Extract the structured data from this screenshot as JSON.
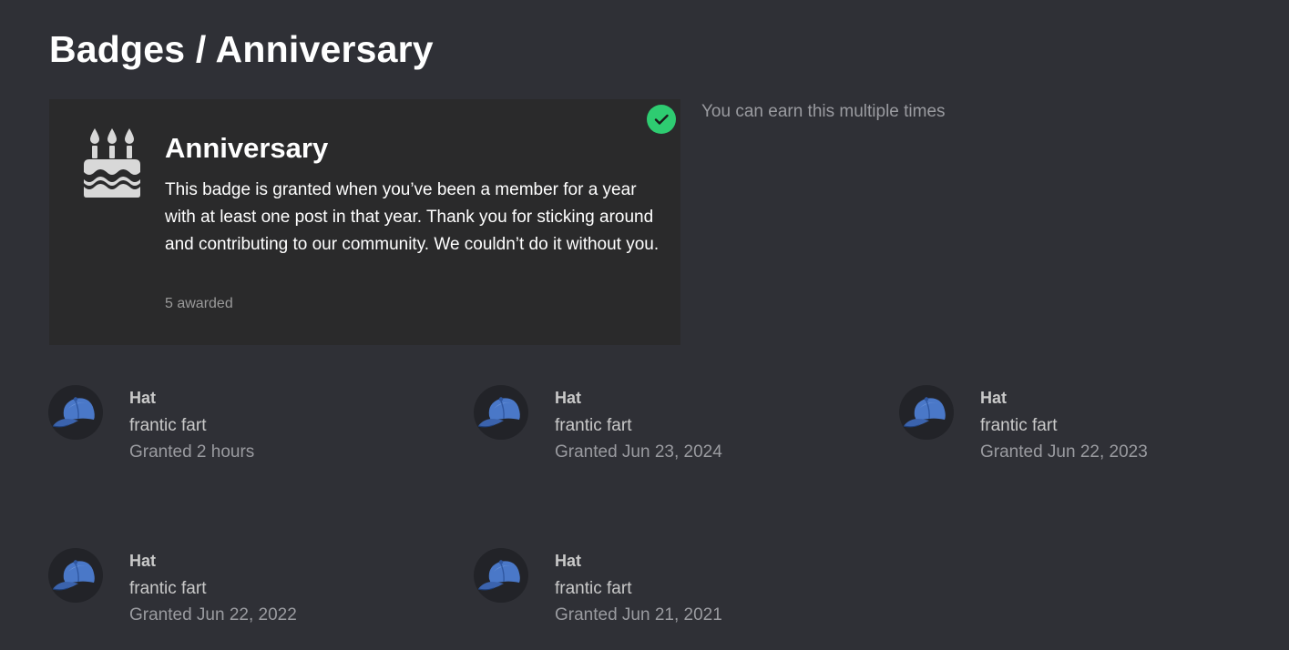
{
  "page": {
    "title": "Badges / Anniversary"
  },
  "badge": {
    "icon": "birthday-cake-icon",
    "name": "Anniversary",
    "description": "This badge is granted when you’ve been a member for a year with at least one post in that year. Thank you for sticking around and contributing to our community. We couldn’t do it without you.",
    "awarded": "5 awarded",
    "granted_icon": "check-circle-icon",
    "earn_note": "You can earn this multiple times"
  },
  "colors": {
    "background": "#2f3036",
    "card": "#2a2a2b",
    "check": "#2ecc71",
    "cap": "#4a78c8"
  },
  "grants": [
    {
      "avatar_icon": "blue-cap-icon",
      "badge_label": "Hat",
      "username": "frantic fart",
      "granted": "Granted 2 hours"
    },
    {
      "avatar_icon": "blue-cap-icon",
      "badge_label": "Hat",
      "username": "frantic fart",
      "granted": "Granted Jun 23, 2024"
    },
    {
      "avatar_icon": "blue-cap-icon",
      "badge_label": "Hat",
      "username": "frantic fart",
      "granted": "Granted Jun 22, 2023"
    },
    {
      "avatar_icon": "blue-cap-icon",
      "badge_label": "Hat",
      "username": "frantic fart",
      "granted": "Granted Jun 22, 2022"
    },
    {
      "avatar_icon": "blue-cap-icon",
      "badge_label": "Hat",
      "username": "frantic fart",
      "granted": "Granted Jun 21, 2021"
    }
  ]
}
